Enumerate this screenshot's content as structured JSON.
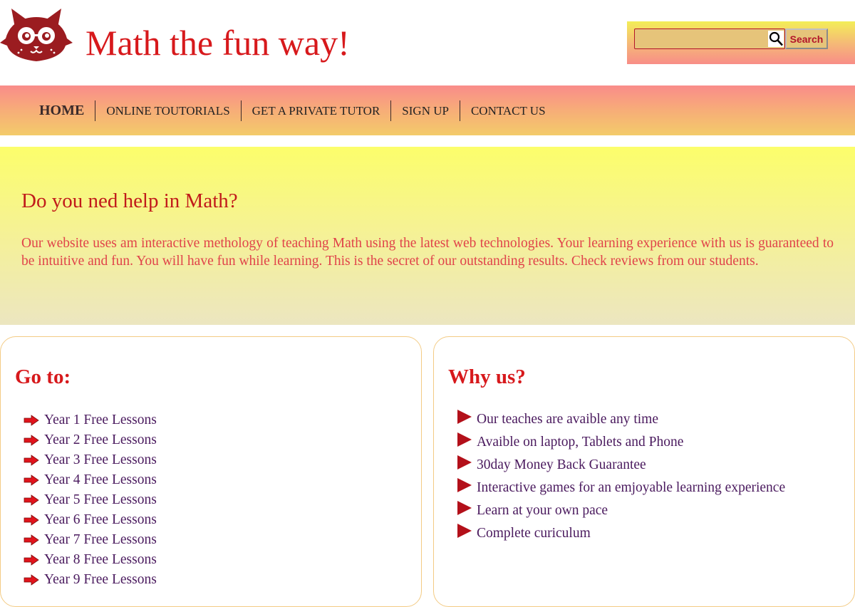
{
  "header": {
    "title": "Math the fun way!",
    "logo_icon": "cat-with-glasses-logo",
    "search": {
      "value": "",
      "placeholder": "",
      "button_label": "Search",
      "icon": "search-icon"
    }
  },
  "nav": {
    "items": [
      {
        "label": "HOME"
      },
      {
        "label": "ONLINE TOUTORIALS"
      },
      {
        "label": "GET A PRIVATE TUTOR"
      },
      {
        "label": "SIGN UP"
      },
      {
        "label": "CONTACT US"
      }
    ]
  },
  "hero": {
    "title": "Do you ned help in Math?",
    "text": "Our website uses am interactive methology of teaching Math using the latest web technologies. Your learning experience with us is guaranteed to be intuitive and fun. You will have fun while learning. This is the secret of our outstanding results. Check reviews from our students."
  },
  "goto": {
    "title": "Go to:",
    "items": [
      {
        "label": "Year 1 Free Lessons"
      },
      {
        "label": "Year 2 Free Lessons"
      },
      {
        "label": "Year 3 Free Lessons"
      },
      {
        "label": "Year 4 Free Lessons"
      },
      {
        "label": "Year 5 Free Lessons"
      },
      {
        "label": "Year 6 Free Lessons"
      },
      {
        "label": "Year 7 Free Lessons"
      },
      {
        "label": "Year 8 Free Lessons"
      },
      {
        "label": "Year 9 Free Lessons"
      }
    ]
  },
  "why": {
    "title": "Why us?",
    "items": [
      {
        "label": "Our teaches are avaible any time"
      },
      {
        "label": "Avaible on laptop, Tablets and Phone"
      },
      {
        "label": "30day Money Back Guarantee"
      },
      {
        "label": "Interactive games for an emjoyable learning experience"
      },
      {
        "label": "Learn at your own pace"
      },
      {
        "label": "Complete curiculum"
      }
    ]
  },
  "colors": {
    "brand_red": "#d7191c",
    "link_purple": "#4a1a5e",
    "hero_text": "#e0434a"
  }
}
